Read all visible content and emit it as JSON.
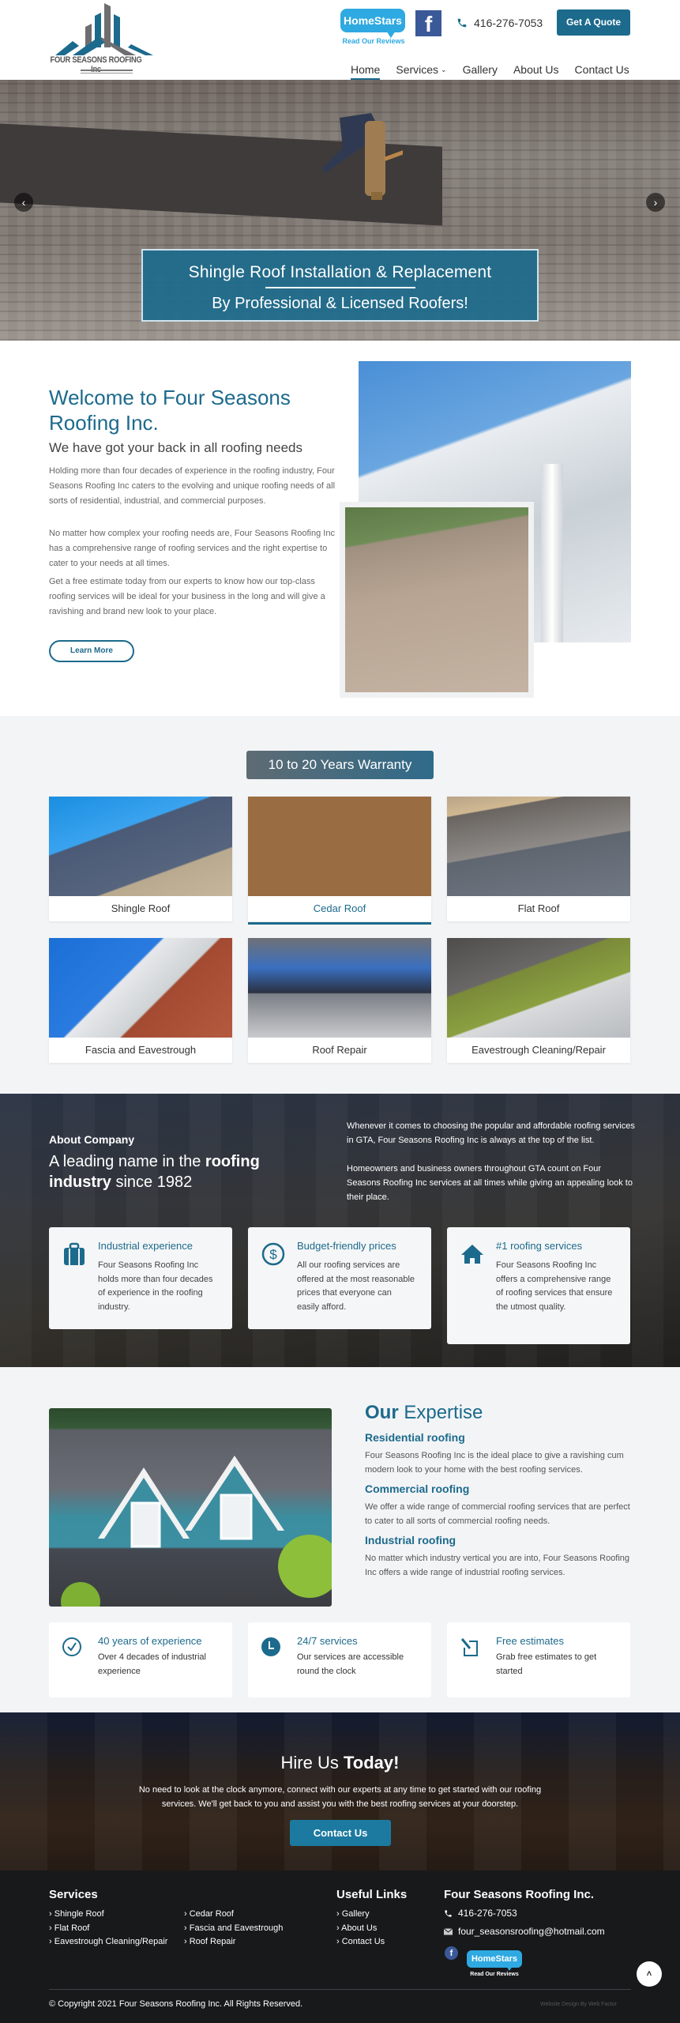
{
  "header": {
    "logo_text": "FOUR SEASONS ROOFING Inc",
    "homestars": {
      "label": "HomeStars",
      "sub": "Read Our Reviews"
    },
    "facebook_glyph": "f",
    "phone": "416-276-7053",
    "quote_button": "Get A Quote",
    "nav": [
      {
        "label": "Home",
        "active": true
      },
      {
        "label": "Services",
        "has_dropdown": true
      },
      {
        "label": "Gallery"
      },
      {
        "label": "About Us"
      },
      {
        "label": "Contact Us"
      }
    ],
    "caret": "⌄"
  },
  "hero": {
    "line1": "Shingle Roof Installation & Replacement",
    "line2": "By Professional & Licensed Roofers!",
    "prev": "‹",
    "next": "›"
  },
  "welcome": {
    "title": "Welcome to Four Seasons Roofing Inc.",
    "subtitle": "We have got your back in all roofing needs",
    "paragraphs": [
      "Holding more than four decades of experience in the roofing industry, Four Seasons Roofing Inc caters to the evolving and unique roofing needs of all sorts of residential, industrial, and commercial purposes.",
      "No matter how complex your roofing needs are, Four Seasons Roofing Inc has a comprehensive range of roofing services and the right expertise to cater to your needs at all times.",
      "Get a free estimate today from our experts to know how our top-class roofing services will be ideal for your business in the long and will give a ravishing and brand new look to your place."
    ],
    "button": "Learn More"
  },
  "services": {
    "badge": "10 to 20 Years Warranty",
    "items": [
      {
        "label": "Shingle Roof"
      },
      {
        "label": "Cedar Roof",
        "active": true
      },
      {
        "label": "Flat Roof"
      },
      {
        "label": "Fascia and Eavestrough"
      },
      {
        "label": "Roof Repair"
      },
      {
        "label": "Eavestrough Cleaning/Repair"
      }
    ]
  },
  "about": {
    "kicker": "About Company",
    "heading_pre": "A leading name in the ",
    "heading_bold": "roofing industry",
    "heading_post": " since 1982",
    "paragraphs": [
      "Whenever it comes to choosing the popular and affordable roofing services in GTA, Four Seasons Roofing Inc is always at the top of the list.",
      "Homeowners and business owners throughout GTA count on Four Seasons Roofing Inc services at all times while giving an appealing look to their place."
    ],
    "features": [
      {
        "icon": "briefcase-icon",
        "title": "Industrial experience",
        "text": "Four Seasons Roofing Inc holds more than four decades of experience in the roofing industry."
      },
      {
        "icon": "dollar-icon",
        "title": "Budget-friendly prices",
        "text": "All our roofing services are offered at the most reasonable prices that everyone can easily afford."
      },
      {
        "icon": "home-icon",
        "title": "#1 roofing services",
        "text": "Four Seasons Roofing Inc offers a comprehensive range of roofing services that ensure the utmost quality."
      }
    ]
  },
  "expertise": {
    "title_bold": "Our",
    "title_rest": " Expertise",
    "items": [
      {
        "heading": "Residential roofing",
        "text": "Four Seasons Roofing Inc is the ideal place to give a ravishing cum modern look to your home with the best roofing services."
      },
      {
        "heading": "Commercial roofing",
        "text": "We offer a wide range of commercial roofing services that are perfect to cater to all sorts of commercial roofing needs."
      },
      {
        "heading": "Industrial roofing",
        "text": "No matter which industry vertical you are into, Four Seasons Roofing Inc offers a wide range of industrial roofing services."
      }
    ],
    "highlights": [
      {
        "icon": "check-circle-icon",
        "title": "40 years of experience",
        "text": "Over 4 decades of industrial experience"
      },
      {
        "icon": "clock-icon",
        "title": "24/7 services",
        "text": "Our services are accessible round the clock"
      },
      {
        "icon": "pen-edit-icon",
        "title": "Free estimates",
        "text": "Grab free estimates to get started"
      }
    ]
  },
  "hire": {
    "title_pre": "Hire Us ",
    "title_bold": "Today!",
    "text": "No need to look at the clock anymore, connect with our experts at any time to get started with our roofing services. We'll get back to you and assist you with the best roofing services at your doorstep.",
    "button": "Contact Us"
  },
  "footer": {
    "services_heading": "Services",
    "services_links": [
      "Shingle Roof",
      "Flat Roof",
      "Eavestrough Cleaning/Repair",
      "Cedar Roof",
      "Fascia and Eavestrough",
      "Roof Repair"
    ],
    "useful_heading": "Useful Links",
    "useful_links": [
      "Gallery",
      "About Us",
      "Contact Us"
    ],
    "company_heading": "Four Seasons Roofing Inc.",
    "phone": "416-276-7053",
    "email": "four_seasonsroofing@hotmail.com",
    "facebook_glyph": "f",
    "homestars": {
      "label": "HomeStars",
      "sub": "Read Our Reviews"
    },
    "to_top": "˄",
    "copyright": "© Copyright 2021 Four Seasons Roofing Inc. All Rights Reserved.",
    "credit": "Website Design By Web Factor"
  },
  "colors": {
    "brand": "#1c6a8c",
    "footer_bg": "#18191b",
    "section_bg": "#f3f4f6",
    "homestars": "#2fa9e1",
    "facebook": "#3b5998"
  }
}
